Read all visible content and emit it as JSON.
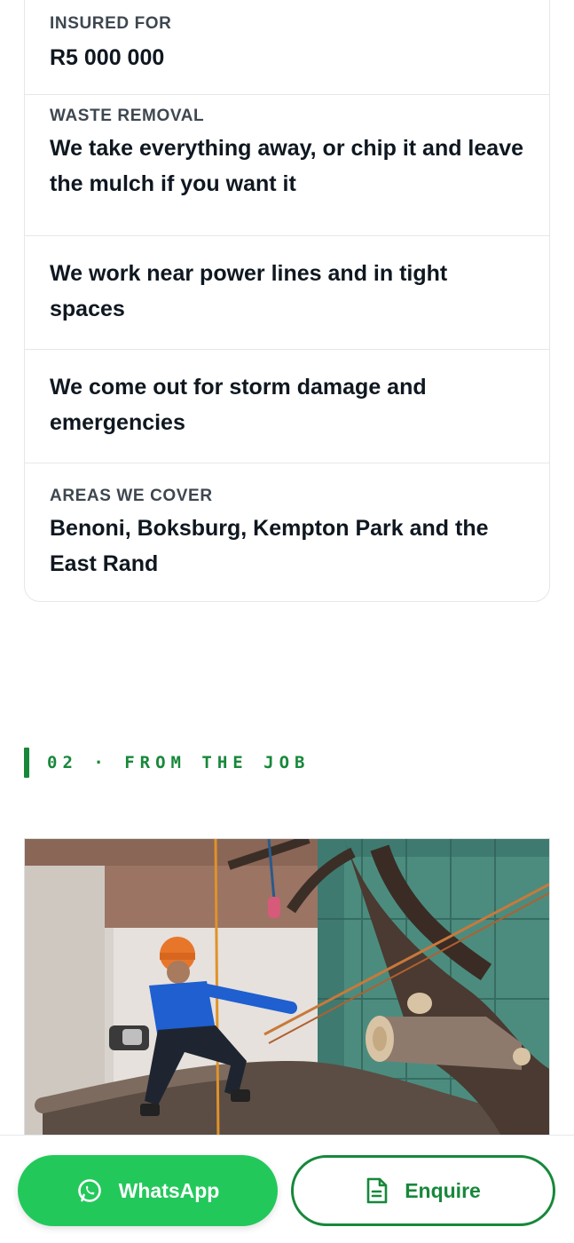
{
  "details": [
    {
      "label": "INSURED FOR",
      "value": "R5 000 000"
    },
    {
      "label": "WASTE REMOVAL",
      "value": "We take everything away, or chip it and leave the mulch if you want it"
    },
    {
      "label": "",
      "value": "We work near power lines and in tight spaces"
    },
    {
      "label": "",
      "value": "We come out for storm damage and emergencies"
    },
    {
      "label": "AREAS WE COVER",
      "value": "Benoni, Boksburg, Kempton Park and the East Rand"
    }
  ],
  "section": {
    "title": "02 · FROM THE JOB"
  },
  "actions": {
    "whatsapp_label": "WhatsApp",
    "enquire_label": "Enquire"
  },
  "colors": {
    "brand_green": "#17883a",
    "whatsapp_green": "#23c85b",
    "text_dark": "#0f1720",
    "label_gray": "#3e4750",
    "divider": "#e5e7ea"
  },
  "icons": {
    "whatsapp": "whatsapp-icon",
    "enquire": "document-icon"
  }
}
